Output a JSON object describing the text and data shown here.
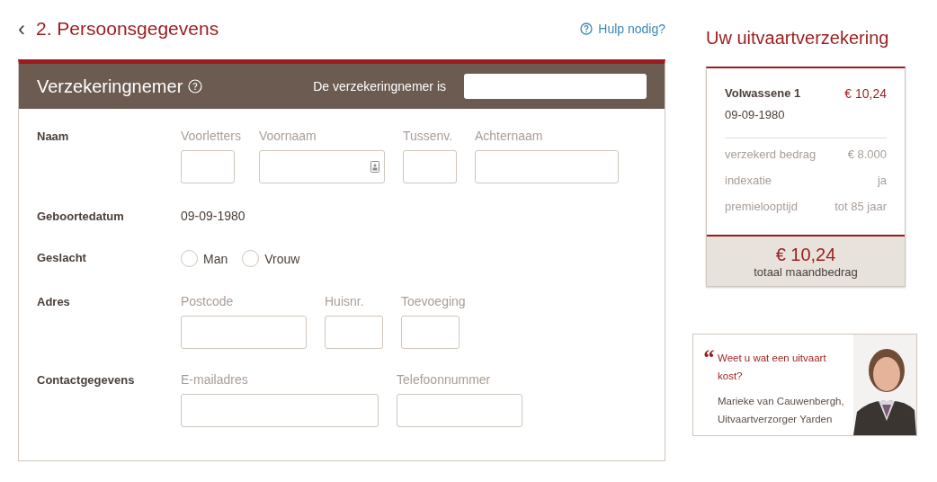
{
  "header": {
    "back_icon": "‹",
    "title": "2. Persoonsgegevens",
    "help_link": "Hulp nodig?"
  },
  "section": {
    "title": "Verzekeringnemer",
    "select_label": "De verzekeringnemer is"
  },
  "rows": [
    {
      "kind": "fields",
      "label": "Naam",
      "fields": [
        {
          "label": "Voorletters",
          "contact_icon": false
        },
        {
          "label": "Voornaam",
          "contact_icon": true
        },
        {
          "label": "Tussenv.",
          "contact_icon": false
        },
        {
          "label": "Achternaam",
          "contact_icon": false
        }
      ]
    },
    {
      "kind": "text",
      "label": "Geboortedatum",
      "value": "09-09-1980"
    },
    {
      "kind": "radio",
      "label": "Geslacht",
      "options": [
        {
          "label": "Man",
          "selected": false
        },
        {
          "label": "Vrouw",
          "selected": false
        }
      ]
    },
    {
      "kind": "fields",
      "label": "Adres",
      "fields": [
        {
          "label": "Postcode",
          "contact_icon": false
        },
        {
          "label": "Huisnr.",
          "contact_icon": false
        },
        {
          "label": "Toevoeging",
          "contact_icon": false
        }
      ]
    },
    {
      "kind": "fields",
      "label": "Contactgegevens",
      "fields": [
        {
          "label": "E-mailadres",
          "contact_icon": false
        },
        {
          "label": "Telefoonnummer",
          "contact_icon": false
        }
      ]
    }
  ],
  "summary": {
    "title": "Uw uitvaartverzekering",
    "person": "Volwassene 1",
    "person_price": "€ 10,24",
    "birthdate": "09-09-1980",
    "details": [
      {
        "label": "verzekerd bedrag",
        "value": "€ 8.000"
      },
      {
        "label": "indexatie",
        "value": "ja"
      },
      {
        "label": "premielooptijd",
        "value": "tot 85 jaar"
      }
    ],
    "total": "€ 10,24",
    "total_label": "totaal maandbedrag"
  },
  "quote": {
    "mark": "“",
    "text": "Weet u wat een uitvaart kost?",
    "author": "Marieke van Cauwenbergh,",
    "role": "Uitvaartverzorger Yarden"
  }
}
